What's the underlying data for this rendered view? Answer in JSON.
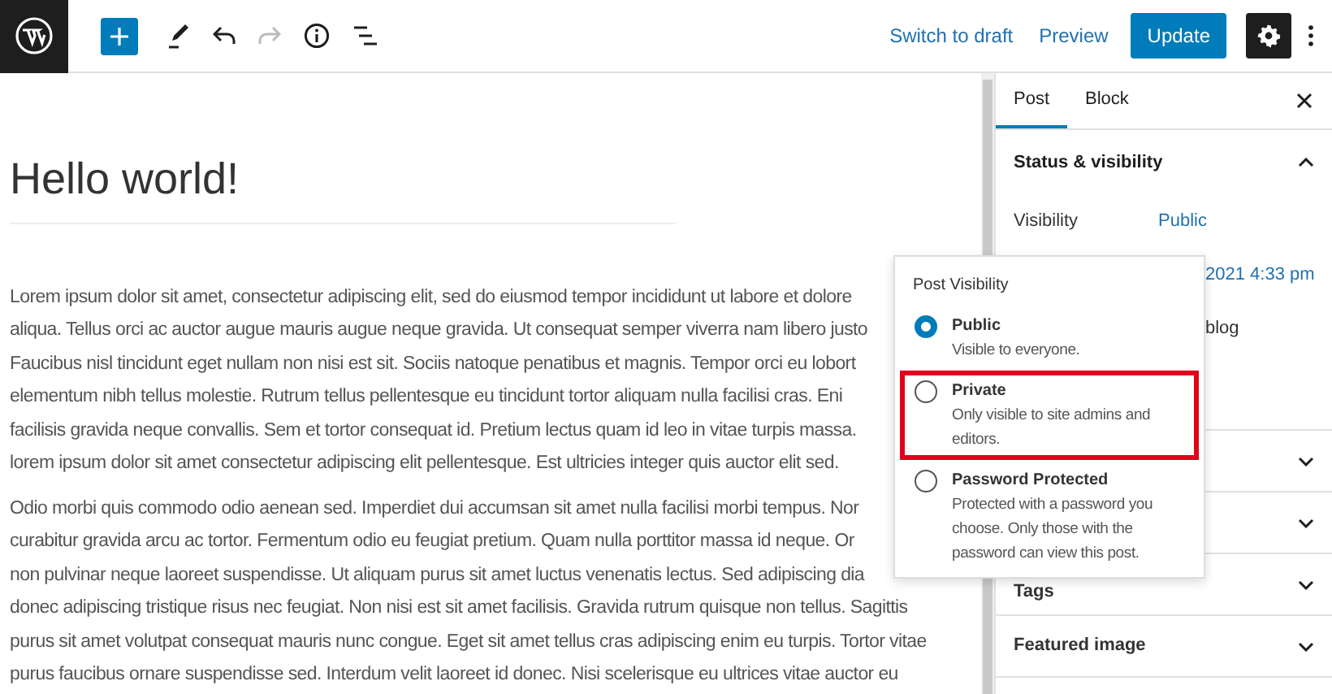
{
  "toolbar": {
    "left_buttons": [
      {
        "kind": "add"
      },
      {
        "kind": "edit"
      },
      {
        "kind": "undo"
      },
      {
        "kind": "redo",
        "disabled": true
      },
      {
        "kind": "info"
      },
      {
        "kind": "outline"
      }
    ],
    "switch_to_draft": "Switch to draft",
    "preview": "Preview",
    "update": "Update"
  },
  "editor": {
    "title": "Hello world!",
    "paragraphs": [
      [
        "Lorem ipsum dolor sit amet, consectetur adipiscing elit, sed do eiusmod tempor incididunt ut labore et dolore",
        "aliqua. Tellus orci ac auctor augue mauris augue neque gravida. Ut consequat semper viverra nam libero justo",
        "Faucibus nisl tincidunt eget nullam non nisi est sit. Sociis natoque penatibus et magnis. Tempor orci eu lobort",
        "elementum nibh tellus molestie. Rutrum tellus pellentesque eu tincidunt tortor aliquam nulla facilisi cras. Eni",
        "facilisis gravida neque convallis. Sem et tortor consequat id. Pretium lectus quam id leo in vitae turpis massa.",
        "lorem ipsum dolor sit amet consectetur adipiscing elit pellentesque. Est ultricies integer quis auctor elit sed."
      ],
      [
        "Odio morbi quis commodo odio aenean sed. Imperdiet dui accumsan sit amet nulla facilisi morbi tempus. Nor",
        "curabitur gravida arcu ac tortor. Fermentum odio eu feugiat pretium. Quam nulla porttitor massa id neque. Or",
        "non pulvinar neque laoreet suspendisse. Ut aliquam purus sit amet luctus venenatis lectus. Sed adipiscing dia",
        "donec adipiscing tristique risus nec feugiat. Non nisi est sit amet facilisis. Gravida rutrum quisque non tellus. Sagittis",
        "purus sit amet volutpat consequat mauris nunc congue. Eget sit amet tellus cras adipiscing enim eu turpis. Tortor vitae",
        "purus faucibus ornare suspendisse sed. Interdum velit laoreet id donec. Nisi scelerisque eu ultrices vitae auctor eu"
      ]
    ]
  },
  "sidebar": {
    "tabs": [
      {
        "label": "Post",
        "selected": true
      },
      {
        "label": "Block",
        "selected": false
      }
    ],
    "status_panel": {
      "title": "Status & visibility",
      "expanded": true,
      "rows": [
        {
          "label": "Visibility",
          "value": "Public"
        },
        {
          "value": "2021 4:33 pm"
        },
        {
          "text": "blog"
        }
      ]
    },
    "panels": [
      {
        "expanded": false
      },
      {
        "expanded": false
      },
      {
        "title": "Tags",
        "expanded": false
      },
      {
        "title": "Featured image",
        "expanded": false
      }
    ]
  },
  "popover": {
    "title": "Post Visibility",
    "options": [
      {
        "label": "Public",
        "description": "Visible to everyone.",
        "selected": true,
        "highlighted": false
      },
      {
        "label": "Private",
        "description": "Only visible to site admins and editors.",
        "selected": false,
        "highlighted": true
      },
      {
        "label": "Password Protected",
        "description": "Protected with a password you choose. Only those with the password can view this post.",
        "selected": false,
        "highlighted": false
      }
    ]
  }
}
